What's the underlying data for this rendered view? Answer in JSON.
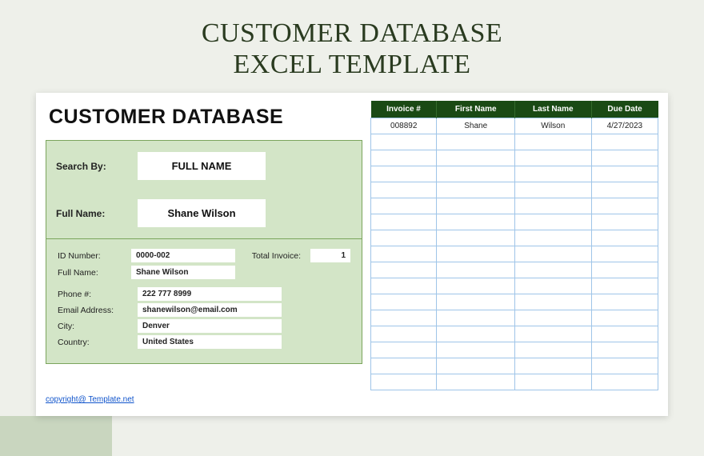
{
  "banner": {
    "line1": "CUSTOMER DATABASE",
    "line2": "EXCEL TEMPLATE"
  },
  "header_title": "CUSTOMER DATABASE",
  "search": {
    "search_by_label": "Search By:",
    "search_by_value": "FULL NAME",
    "full_name_label": "Full Name:",
    "full_name_value": "Shane Wilson"
  },
  "details": {
    "id_label": "ID Number:",
    "id_value": "0000-002",
    "fullname_label": "Full Name:",
    "fullname_value": "Shane Wilson",
    "total_invoice_label": "Total Invoice:",
    "total_invoice_value": "1",
    "phone_label": "Phone #:",
    "phone_value": "222 777 8999",
    "email_label": "Email Address:",
    "email_value": "shanewilson@email.com",
    "city_label": "City:",
    "city_value": "Denver",
    "country_label": "Country:",
    "country_value": "United States"
  },
  "table": {
    "headers": [
      "Invoice #",
      "First Name",
      "Last Name",
      "Due Date"
    ],
    "rows": [
      {
        "invoice": "008892",
        "first": "Shane",
        "last": "Wilson",
        "due": "4/27/2023"
      }
    ]
  },
  "copyright": "copyright@ Template.net"
}
